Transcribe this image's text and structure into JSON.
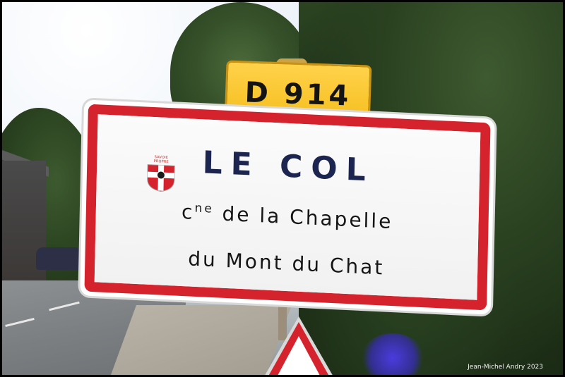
{
  "route_plate": {
    "text": "D 914"
  },
  "town_sign": {
    "name": "LE COL",
    "commune_prefix": "c",
    "commune_prefix_sup": "ne",
    "commune_line1_rest": " de la Chapelle",
    "commune_line2": "du Mont du Chat",
    "coat_of_arms_banner": "SAVOIE PROPRE"
  },
  "credit": "Jean-Michel Andry 2023",
  "colors": {
    "sign_red": "#d4232d",
    "plate_yellow": "#f5bd1c",
    "town_name_blue": "#1c2550"
  }
}
